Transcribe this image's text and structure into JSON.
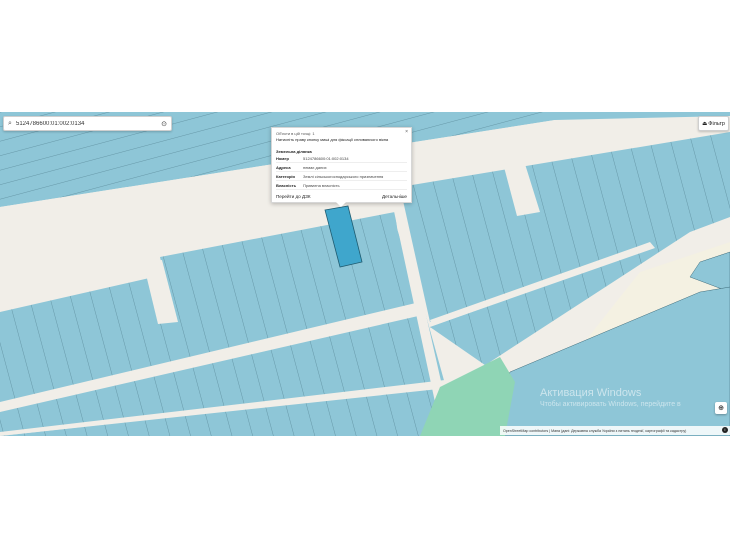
{
  "search": {
    "icon": "search-icon",
    "value": "5124786600:01:002:0134",
    "locate_icon": "crosshair-icon"
  },
  "filter": {
    "icon": "filter-icon",
    "label": "Фільтр"
  },
  "popup": {
    "line1": "Об'єкти в цій точці: 1",
    "line2": "Натисніть праву кнопку миші для фіксації спливаючого вікна",
    "section": "Земельна ділянка",
    "rows": [
      {
        "key": "Номер",
        "value": "5124786600:01:002:0134"
      },
      {
        "key": "Адреса",
        "value": "немає даних"
      },
      {
        "key": "Категорія",
        "value": "Землі сільськогосподарського призначення"
      },
      {
        "key": "Власність",
        "value": "Приватна власність"
      }
    ],
    "go_label": "Перейти до ДЗК",
    "details_label": "Детальніше",
    "close_icon": "close-icon"
  },
  "watermark": {
    "title": "Активация Windows",
    "subtitle": "Чтобы активировать Windows, перейдите в"
  },
  "attribution": "OpenStreetMap contributors | Мапа (дані: Державна служба України з питань геодезії, картографії та кадастру)",
  "colors": {
    "parcel": "#8ec6d7",
    "parcel_stroke": "#3e6b7a",
    "selected": "#3fa6cc",
    "road": "#f1eee8",
    "green": "#8fd5b5"
  }
}
